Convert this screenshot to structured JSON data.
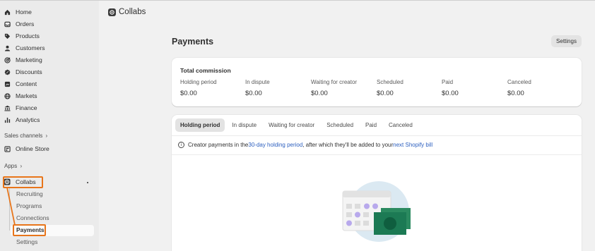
{
  "sidebar": {
    "items": [
      {
        "label": "Home",
        "icon": "home-icon"
      },
      {
        "label": "Orders",
        "icon": "inbox-icon"
      },
      {
        "label": "Products",
        "icon": "tag-icon"
      },
      {
        "label": "Customers",
        "icon": "person-icon"
      },
      {
        "label": "Marketing",
        "icon": "target-icon"
      },
      {
        "label": "Discounts",
        "icon": "discount-icon"
      },
      {
        "label": "Content",
        "icon": "content-icon"
      },
      {
        "label": "Markets",
        "icon": "globe-icon"
      },
      {
        "label": "Finance",
        "icon": "bank-icon"
      },
      {
        "label": "Analytics",
        "icon": "bar-chart-icon"
      }
    ],
    "sales_channels_label": "Sales channels",
    "online_store": "Online Store",
    "apps_label": "Apps",
    "collabs": "Collabs",
    "collabs_sub": [
      "Recruiting",
      "Programs",
      "Connections",
      "Payments",
      "Settings"
    ]
  },
  "header": {
    "app_title": "Collabs"
  },
  "page": {
    "title": "Payments",
    "settings_label": "Settings"
  },
  "commission": {
    "title": "Total commission",
    "stats": [
      {
        "label": "Holding period",
        "value": "$0.00"
      },
      {
        "label": "In dispute",
        "value": "$0.00"
      },
      {
        "label": "Waiting for creator",
        "value": "$0.00"
      },
      {
        "label": "Scheduled",
        "value": "$0.00"
      },
      {
        "label": "Paid",
        "value": "$0.00"
      },
      {
        "label": "Canceled",
        "value": "$0.00"
      }
    ]
  },
  "tabs": [
    "Holding period",
    "In dispute",
    "Waiting for creator",
    "Scheduled",
    "Paid",
    "Canceled"
  ],
  "info": {
    "part1": "Creator payments in the ",
    "link1": "30-day holding period",
    "part2": ", after which they'll be added to your ",
    "link2": "next Shopify bill"
  },
  "colors": {
    "highlight": "#e8751a",
    "link": "#2c5fbf",
    "illustration_green": "#1c7a54"
  }
}
